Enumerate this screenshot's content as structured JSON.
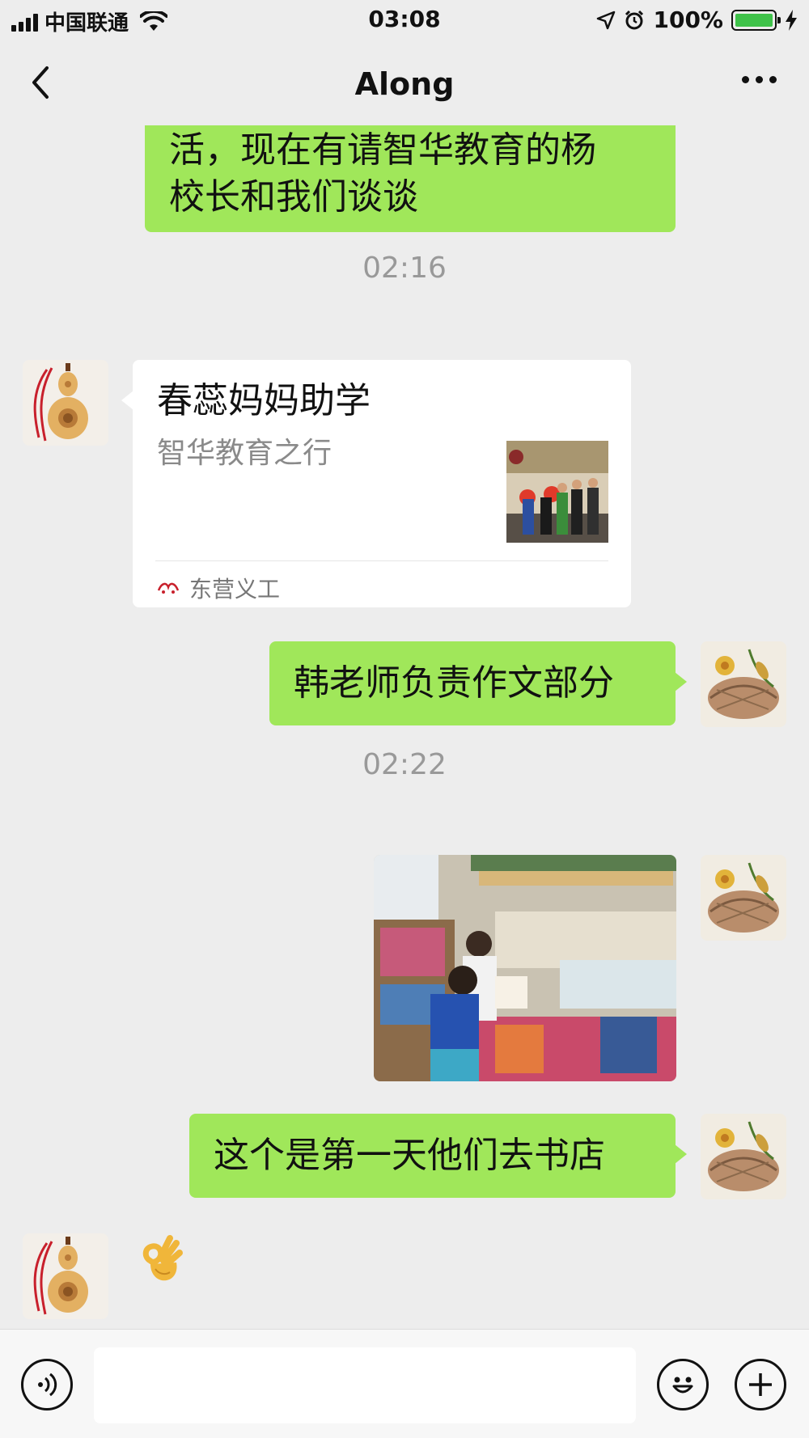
{
  "status_bar": {
    "carrier": "中国联通",
    "time": "03:08",
    "battery_percent": "100%",
    "battery_level": 1.0,
    "icons": [
      "signal-icon",
      "wifi-icon",
      "location-icon",
      "alarm-icon",
      "battery-icon",
      "charging-icon"
    ]
  },
  "nav": {
    "title": "Along",
    "back_icon": "chevron-left-icon",
    "more_icon": "more-dots-icon"
  },
  "messages": [
    {
      "type": "text",
      "side": "right",
      "lines": [
        "活，现在有请智华教育的杨",
        "校长和我们谈谈"
      ]
    },
    {
      "type": "timestamp",
      "text": "02:16"
    },
    {
      "type": "link-card",
      "side": "left",
      "title": "春蕊妈妈助学",
      "description": "智华教育之行",
      "source": "东营义工"
    },
    {
      "type": "text",
      "side": "right",
      "text": "韩老师负责作文部分"
    },
    {
      "type": "timestamp",
      "text": "02:22"
    },
    {
      "type": "image",
      "side": "right",
      "subject": "children reading in bookstore"
    },
    {
      "type": "text",
      "side": "right",
      "text": "这个是第一天他们去书店"
    },
    {
      "type": "emoji",
      "side": "left",
      "emoji": "👌"
    }
  ],
  "input_bar": {
    "voice_icon": "voice-icon",
    "emoji_icon": "smiley-icon",
    "plus_icon": "plus-icon",
    "input_value": ""
  },
  "colors": {
    "background": "#ededed",
    "my_bubble": "#a0e75a",
    "other_bubble": "#ffffff",
    "timestamp": "#999999",
    "battery": "#3fc24a"
  }
}
